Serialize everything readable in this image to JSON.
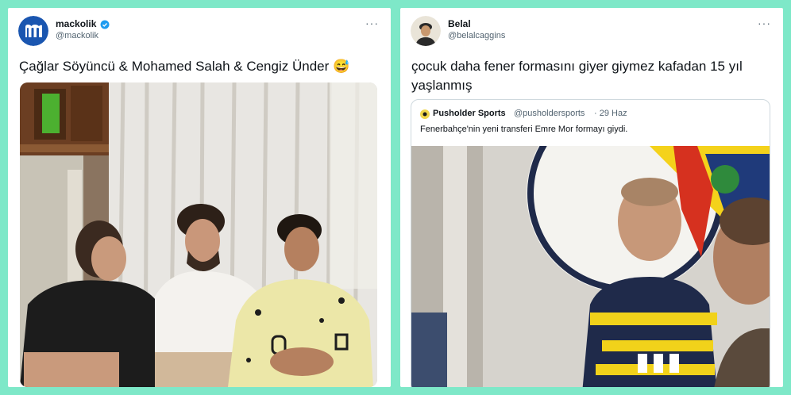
{
  "left_tweet": {
    "user_name": "mackolik",
    "user_handle": "@mackolik",
    "verified": true,
    "avatar_icon": "mackolik-logo-icon",
    "more_icon": "more-dots-icon",
    "text": "Çağlar Söyüncü & Mohamed Salah & Cengiz Ünder 😅"
  },
  "right_tweet": {
    "user_name": "Belal",
    "user_handle": "@belalcaggins",
    "avatar_icon": "user-avatar-icon",
    "more_icon": "more-dots-icon",
    "text": "çocuk daha fener formasını giyer giymez kafadan 15 yıl yaşlanmış",
    "quoted": {
      "user_name": "Pusholder Sports",
      "user_handle": "@pusholdersports",
      "date": "· 29 Haz",
      "text": "Fenerbahçe'nin yeni transferi Emre Mor formayı giydi."
    }
  },
  "colors": {
    "background": "#7ee8c8",
    "card": "#ffffff",
    "verified": "#1d9bf0",
    "mackolik_blue": "#1a56b0"
  }
}
